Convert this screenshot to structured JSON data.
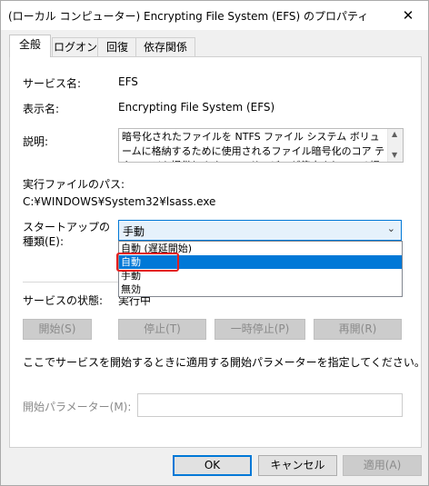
{
  "window": {
    "title": "(ローカル コンピューター) Encrypting File System (EFS) のプロパティ",
    "close_glyph": "✕"
  },
  "tabs": [
    {
      "label": "全般",
      "active": true
    },
    {
      "label": "ログオン",
      "active": false
    },
    {
      "label": "回復",
      "active": false
    },
    {
      "label": "依存関係",
      "active": false
    }
  ],
  "general": {
    "service_name_label": "サービス名:",
    "service_name_value": "EFS",
    "display_name_label": "表示名:",
    "display_name_value": "Encrypting File System (EFS)",
    "description_label": "説明:",
    "description_text": "暗号化されたファイルを NTFS ファイル システム ボリュームに格納するために使用されるファイル暗号化のコア テクノロジを提供します。このサービスが停止されている場合や無効な場合は",
    "exe_path_label": "実行ファイルのパス:",
    "exe_path_value": "C:¥WINDOWS¥System32¥lsass.exe",
    "startup_type_label_1": "スタートアップの",
    "startup_type_label_2": "種類(E):",
    "startup_type_value": "手動",
    "startup_options": [
      "自動 (遅延開始)",
      "自動",
      "手動",
      "無効"
    ],
    "startup_selected_option": "自動",
    "status_label": "サービスの状態:",
    "status_value": "実行中",
    "buttons": {
      "start": "開始(S)",
      "stop": "停止(T)",
      "pause": "一時停止(P)",
      "resume": "再開(R)"
    },
    "params_hint": "ここでサービスを開始するときに適用する開始パラメーターを指定してください。",
    "params_label": "開始パラメーター(M):",
    "params_value": ""
  },
  "footer": {
    "ok": "OK",
    "cancel": "キャンセル",
    "apply": "適用(A)"
  },
  "colors": {
    "accent": "#0078d7",
    "highlight_box": "#e51d1d"
  }
}
